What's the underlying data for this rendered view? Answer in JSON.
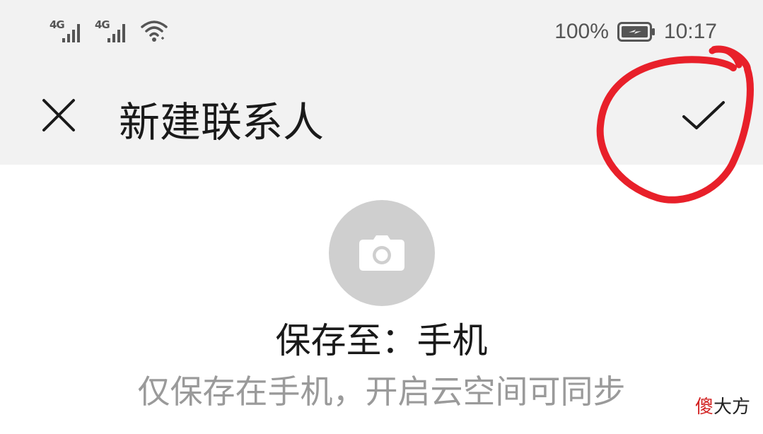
{
  "status_bar": {
    "network_1": "4G",
    "network_2": "4G",
    "battery_percent": "100%",
    "time": "10:17",
    "icons": [
      "signal-icon",
      "signal-icon",
      "wifi-icon",
      "battery-charging-icon"
    ]
  },
  "header": {
    "title": "新建联系人",
    "close_icon": "close-icon",
    "confirm_icon": "check-icon"
  },
  "avatar": {
    "icon": "camera-icon"
  },
  "save_location": {
    "label": "保存至：手机",
    "hint": "仅保存在手机，开启云空间可同步"
  },
  "watermark": {
    "red_part": "傻",
    "black_part": "大方"
  },
  "colors": {
    "header_bg": "#f2f2f2",
    "avatar_bg": "#cfcfcf",
    "annotation": "#e8202a",
    "hint_text": "#9a9a9a"
  }
}
